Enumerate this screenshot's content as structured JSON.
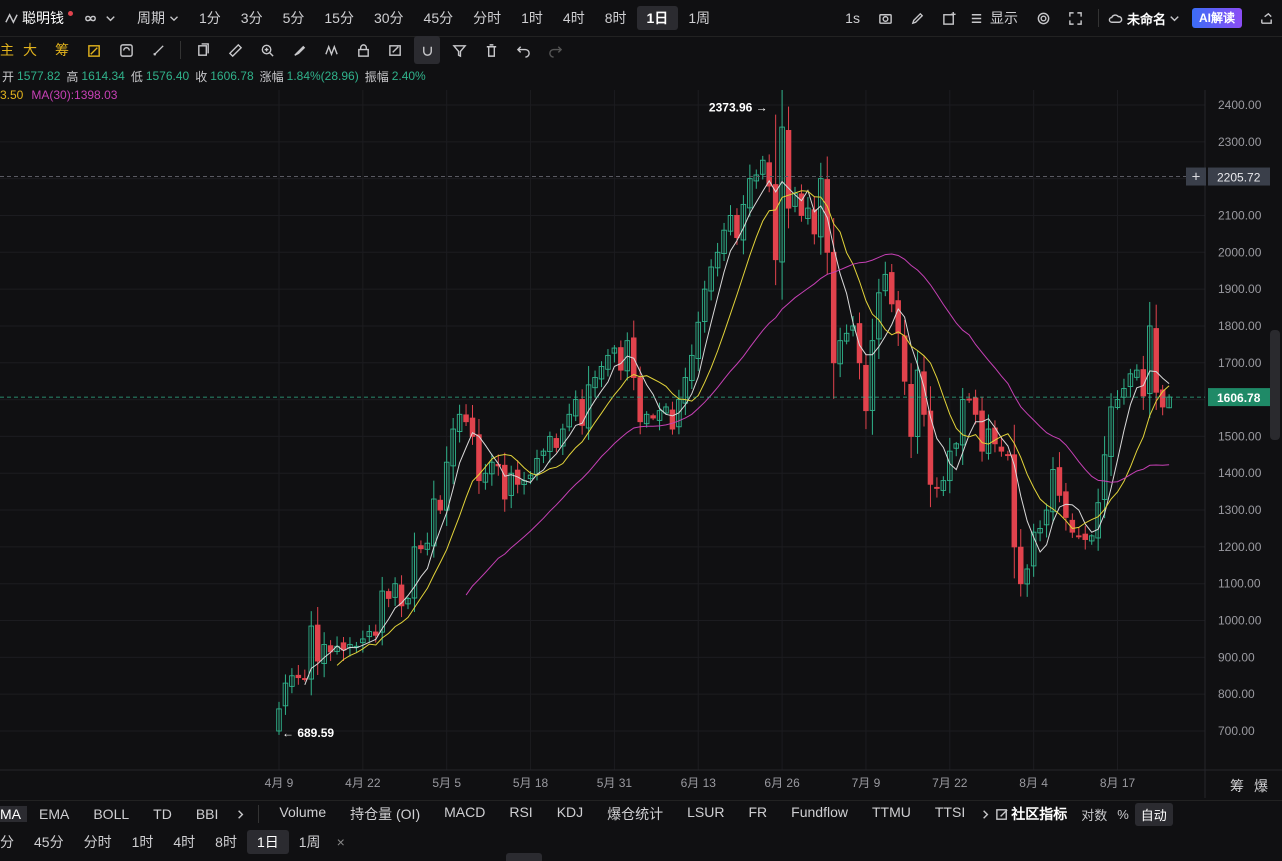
{
  "header": {
    "symbol": "聪明钱",
    "period_label": "周期",
    "timeframes": [
      "1分",
      "3分",
      "5分",
      "15分",
      "30分",
      "45分",
      "分时",
      "1时",
      "4时",
      "8时",
      "1日",
      "1周"
    ],
    "active_timeframe": "1日",
    "interval": "1s",
    "display_label": "显示",
    "layout_name": "未命名",
    "ai_label": "AI解读"
  },
  "toolbar": {
    "tools": [
      "主",
      "大",
      "筹"
    ]
  },
  "ohlc": {
    "open_label": "开",
    "open": "1577.82",
    "high_label": "高",
    "high": "1614.34",
    "low_label": "低",
    "low": "1576.40",
    "close_label": "收",
    "close": "1606.78",
    "change_label": "涨幅",
    "change": "1.84%(28.96)",
    "amp_label": "振幅",
    "amp": "2.40%"
  },
  "ma_legend": {
    "ma_prev": "3.50",
    "ma30": "MA(30):1398.03"
  },
  "indicators": {
    "main": [
      "MA",
      "EMA",
      "BOLL",
      "TD",
      "BBI"
    ],
    "active_main": "MA",
    "sub": [
      "Volume",
      "持仓量 (OI)",
      "MACD",
      "RSI",
      "KDJ",
      "爆仓统计",
      "LSUR",
      "FR",
      "Fundflow",
      "TTMU",
      "TTSI"
    ],
    "community": "社区指标",
    "log_label": "对数",
    "pct_label": "%",
    "auto_label": "自动"
  },
  "period_bar": {
    "items": [
      "分",
      "45分",
      "分时",
      "1时",
      "4时",
      "8时",
      "1日",
      "1周"
    ],
    "active": "1日",
    "close": "×"
  },
  "right_buttons": [
    "筹",
    "爆"
  ],
  "chart_data": {
    "type": "candlestick",
    "y_ticks": [
      700,
      800,
      900,
      1000,
      1100,
      1200,
      1300,
      1400,
      1500,
      1600,
      1700,
      1800,
      1900,
      2000,
      2100,
      2200,
      2300,
      2400
    ],
    "ylim": [
      650,
      2420
    ],
    "x_ticks": [
      "4月 9",
      "4月 22",
      "5月 5",
      "5月 18",
      "5月 31",
      "6月 13",
      "6月 26",
      "7月 9",
      "7月 22",
      "8月 4",
      "8月 17"
    ],
    "x_tick_index": [
      0,
      13,
      26,
      39,
      52,
      65,
      78,
      91,
      104,
      117,
      130
    ],
    "crosshair_price": "2205.72",
    "crosshair_value": 2205.72,
    "last_price": "1606.78",
    "last_value": 1606.78,
    "max_label": "2373.96",
    "max_value": 2373.96,
    "max_index": 77,
    "min_label": "689.59",
    "min_value": 689.59,
    "min_index": 0,
    "colors": {
      "up": "#30b28b",
      "down": "#e1434d",
      "ma5": "#d9d9d9",
      "ma10": "#e2d33a",
      "ma30": "#c640b5",
      "last_box": "#1f8a67",
      "cross_box": "#3a3f4a"
    },
    "closes": [
      760,
      830,
      850,
      845,
      842,
      985,
      890,
      935,
      915,
      930,
      920,
      935,
      930,
      950,
      970,
      960,
      1080,
      1060,
      1100,
      1040,
      1060,
      1200,
      1195,
      1210,
      1330,
      1300,
      1430,
      1520,
      1560,
      1540,
      1500,
      1380,
      1400,
      1430,
      1420,
      1330,
      1400,
      1370,
      1380,
      1395,
      1440,
      1460,
      1500,
      1470,
      1520,
      1560,
      1600,
      1530,
      1640,
      1660,
      1690,
      1720,
      1740,
      1680,
      1760,
      1660,
      1540,
      1560,
      1550,
      1570,
      1580,
      1520,
      1600,
      1660,
      1720,
      1810,
      1900,
      1960,
      2000,
      2060,
      2100,
      2040,
      2130,
      2200,
      2210,
      2250,
      2180,
      1980,
      2340,
      2120,
      2160,
      2100,
      2120,
      2050,
      2200,
      2000,
      1700,
      1760,
      1780,
      1800,
      1700,
      1570,
      1760,
      1890,
      1940,
      1860,
      1780,
      1650,
      1500,
      1680,
      1560,
      1370,
      1360,
      1380,
      1460,
      1480,
      1600,
      1600,
      1560,
      1460,
      1520,
      1480,
      1460,
      1450,
      1200,
      1100,
      1140,
      1240,
      1250,
      1300,
      1410,
      1340,
      1280,
      1240,
      1230,
      1220,
      1230,
      1320,
      1450,
      1580,
      1600,
      1630,
      1670,
      1680,
      1610,
      1800,
      1620,
      1580,
      1606.78
    ]
  }
}
